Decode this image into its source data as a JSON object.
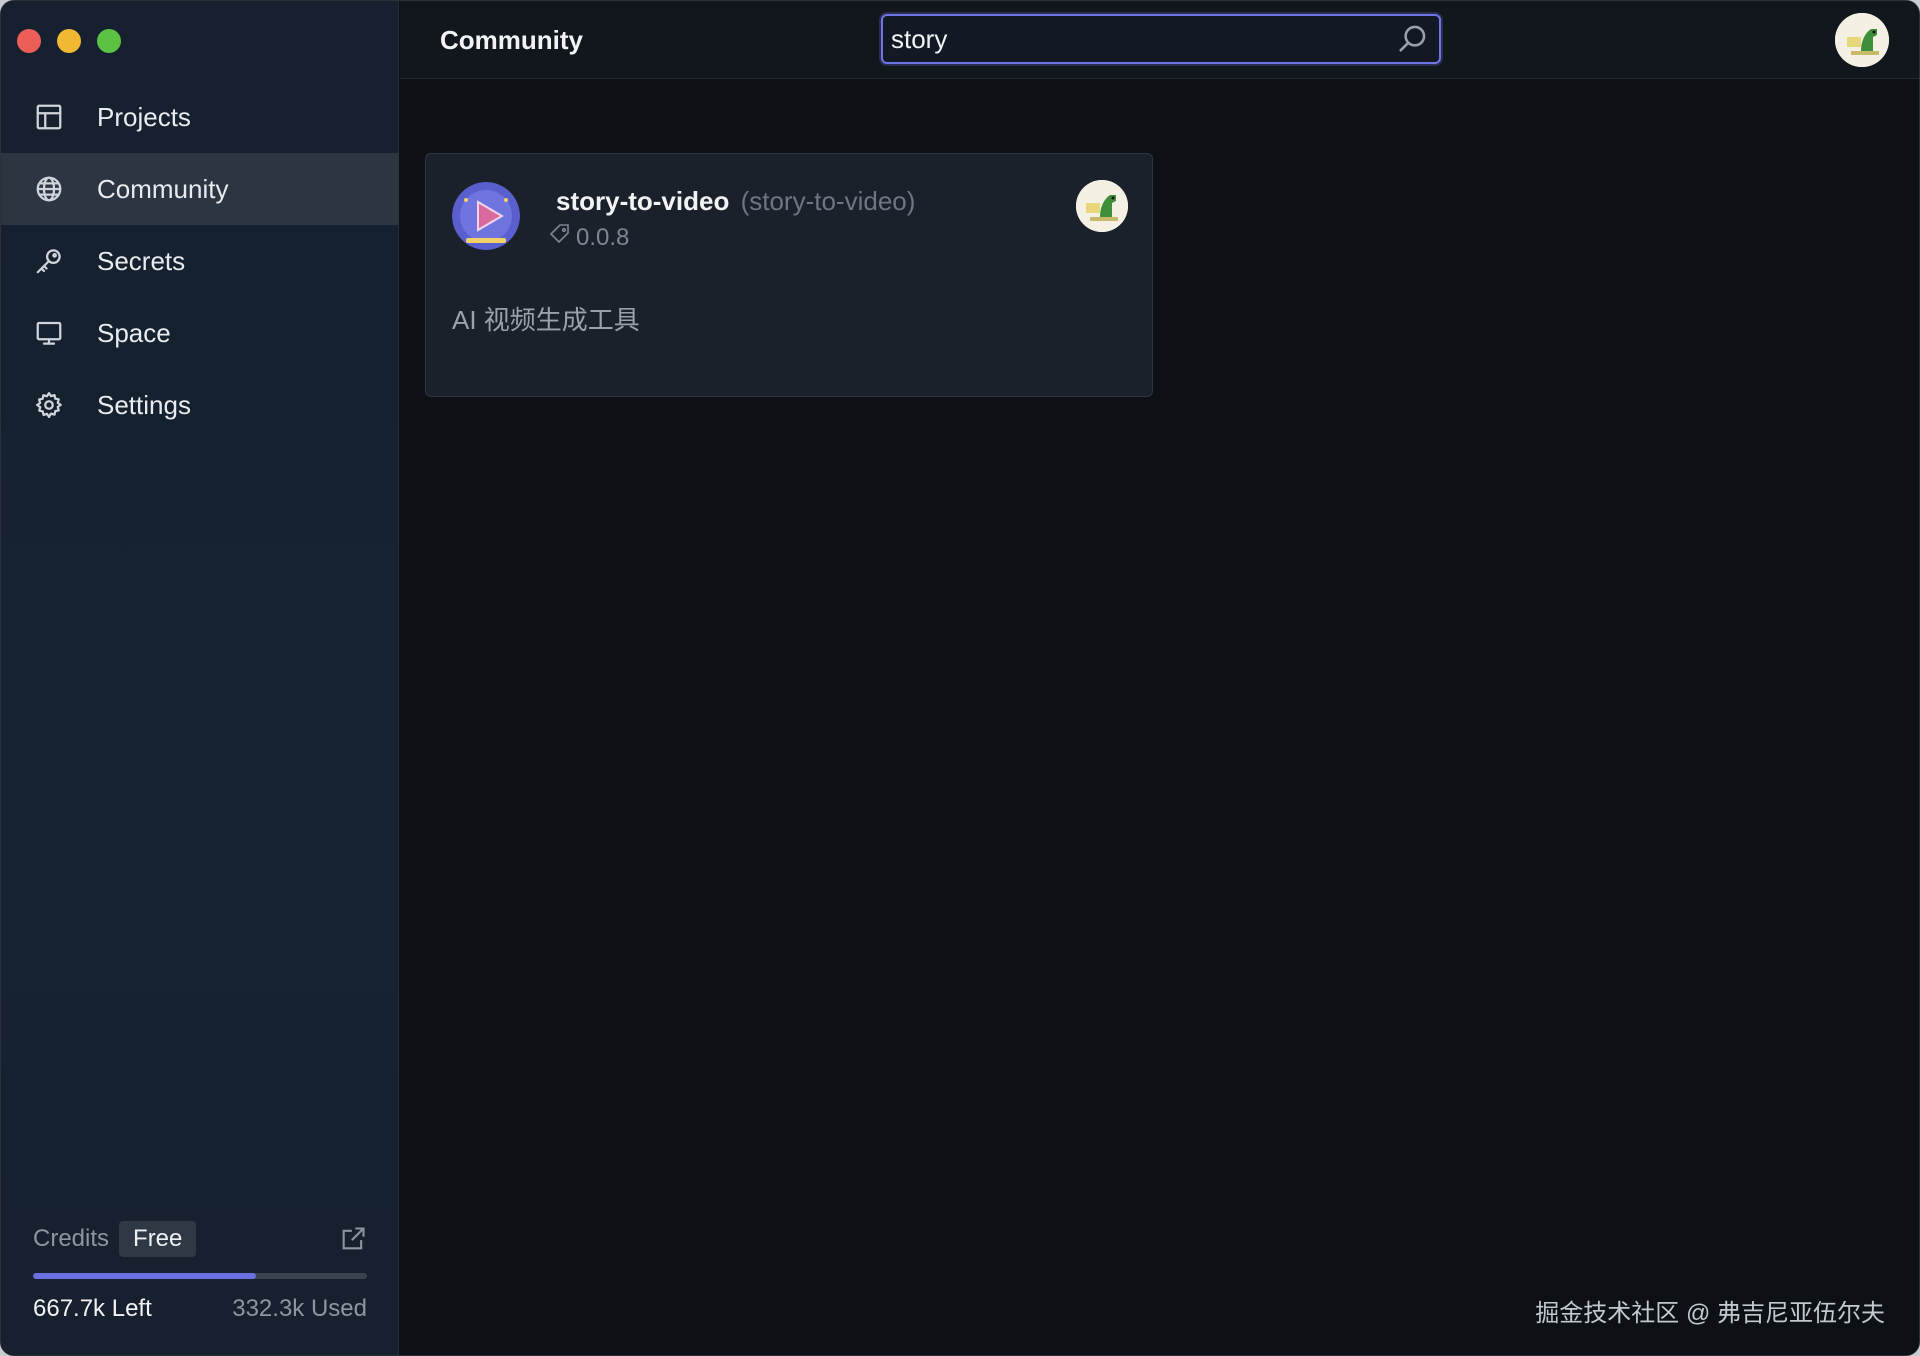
{
  "window": {
    "traffic_lights": [
      "close",
      "minimize",
      "zoom"
    ]
  },
  "sidebar": {
    "items": [
      {
        "label": "Projects",
        "icon": "grid-icon",
        "active": false
      },
      {
        "label": "Community",
        "icon": "globe-icon",
        "active": true
      },
      {
        "label": "Secrets",
        "icon": "key-icon",
        "active": false
      },
      {
        "label": "Space",
        "icon": "monitor-icon",
        "active": false
      },
      {
        "label": "Settings",
        "icon": "gear-icon",
        "active": false
      }
    ],
    "credits": {
      "label": "Credits",
      "plan": "Free",
      "left": "667.7k Left",
      "used": "332.3k Used",
      "used_fraction": 0.668
    }
  },
  "header": {
    "title": "Community",
    "search": {
      "value": "story",
      "icon": "search-icon"
    },
    "avatar": "user-avatar"
  },
  "results": [
    {
      "name": "story-to-video",
      "slug": "(story-to-video)",
      "version": "0.0.8",
      "description": "AI 视频生成工具",
      "icon": "play-icon",
      "author_avatar": "author-avatar"
    }
  ],
  "watermark": "掘金技术社区 @ 弗吉尼亚伍尔夫",
  "colors": {
    "accent": "#6b6fe0",
    "sidebar_bg": "#16202e",
    "main_bg": "#0d1116",
    "card_bg": "#1b212a"
  }
}
